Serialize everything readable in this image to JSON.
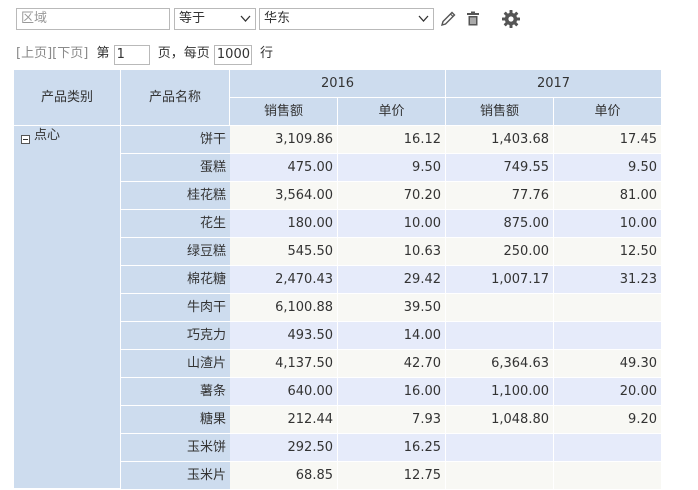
{
  "filter": {
    "field_placeholder": "区域",
    "operator_value": "等于",
    "value": "华东",
    "icons": [
      "pencil-icon",
      "trash-icon",
      "gear-icon"
    ]
  },
  "pager": {
    "prev_label": "[上页]",
    "next_label": "[下页]",
    "page_prefix": "第",
    "page_value": "1",
    "page_suffix": "页，每页",
    "per_page_value": "1000",
    "per_page_suffix": "行"
  },
  "table": {
    "headers": {
      "category": "产品类别",
      "product": "产品名称",
      "year1": "2016",
      "year2": "2017",
      "sales": "销售额",
      "price": "单价"
    },
    "group": {
      "label": "点心",
      "toggle_icon": "collapse-minus-icon"
    },
    "rows": [
      {
        "name": "饼干",
        "s2016": "3,109.86",
        "p2016": "16.12",
        "s2017": "1,403.68",
        "p2017": "17.45"
      },
      {
        "name": "蛋糕",
        "s2016": "475.00",
        "p2016": "9.50",
        "s2017": "749.55",
        "p2017": "9.50"
      },
      {
        "name": "桂花糕",
        "s2016": "3,564.00",
        "p2016": "70.20",
        "s2017": "77.76",
        "p2017": "81.00"
      },
      {
        "name": "花生",
        "s2016": "180.00",
        "p2016": "10.00",
        "s2017": "875.00",
        "p2017": "10.00"
      },
      {
        "name": "绿豆糕",
        "s2016": "545.50",
        "p2016": "10.63",
        "s2017": "250.00",
        "p2017": "12.50"
      },
      {
        "name": "棉花糖",
        "s2016": "2,470.43",
        "p2016": "29.42",
        "s2017": "1,007.17",
        "p2017": "31.23"
      },
      {
        "name": "牛肉干",
        "s2016": "6,100.88",
        "p2016": "39.50",
        "s2017": "",
        "p2017": ""
      },
      {
        "name": "巧克力",
        "s2016": "493.50",
        "p2016": "14.00",
        "s2017": "",
        "p2017": ""
      },
      {
        "name": "山渣片",
        "s2016": "4,137.50",
        "p2016": "42.70",
        "s2017": "6,364.63",
        "p2017": "49.30"
      },
      {
        "name": "薯条",
        "s2016": "640.00",
        "p2016": "16.00",
        "s2017": "1,100.00",
        "p2017": "20.00"
      },
      {
        "name": "糖果",
        "s2016": "212.44",
        "p2016": "7.93",
        "s2017": "1,048.80",
        "p2017": "9.20"
      },
      {
        "name": "玉米饼",
        "s2016": "292.50",
        "p2016": "16.25",
        "s2017": "",
        "p2017": ""
      },
      {
        "name": "玉米片",
        "s2016": "68.85",
        "p2016": "12.75",
        "s2017": "",
        "p2017": ""
      }
    ]
  },
  "colors": {
    "header_bg": "#cddcee",
    "row_odd": "#f8f8f4",
    "row_even": "#e6ebfa"
  }
}
